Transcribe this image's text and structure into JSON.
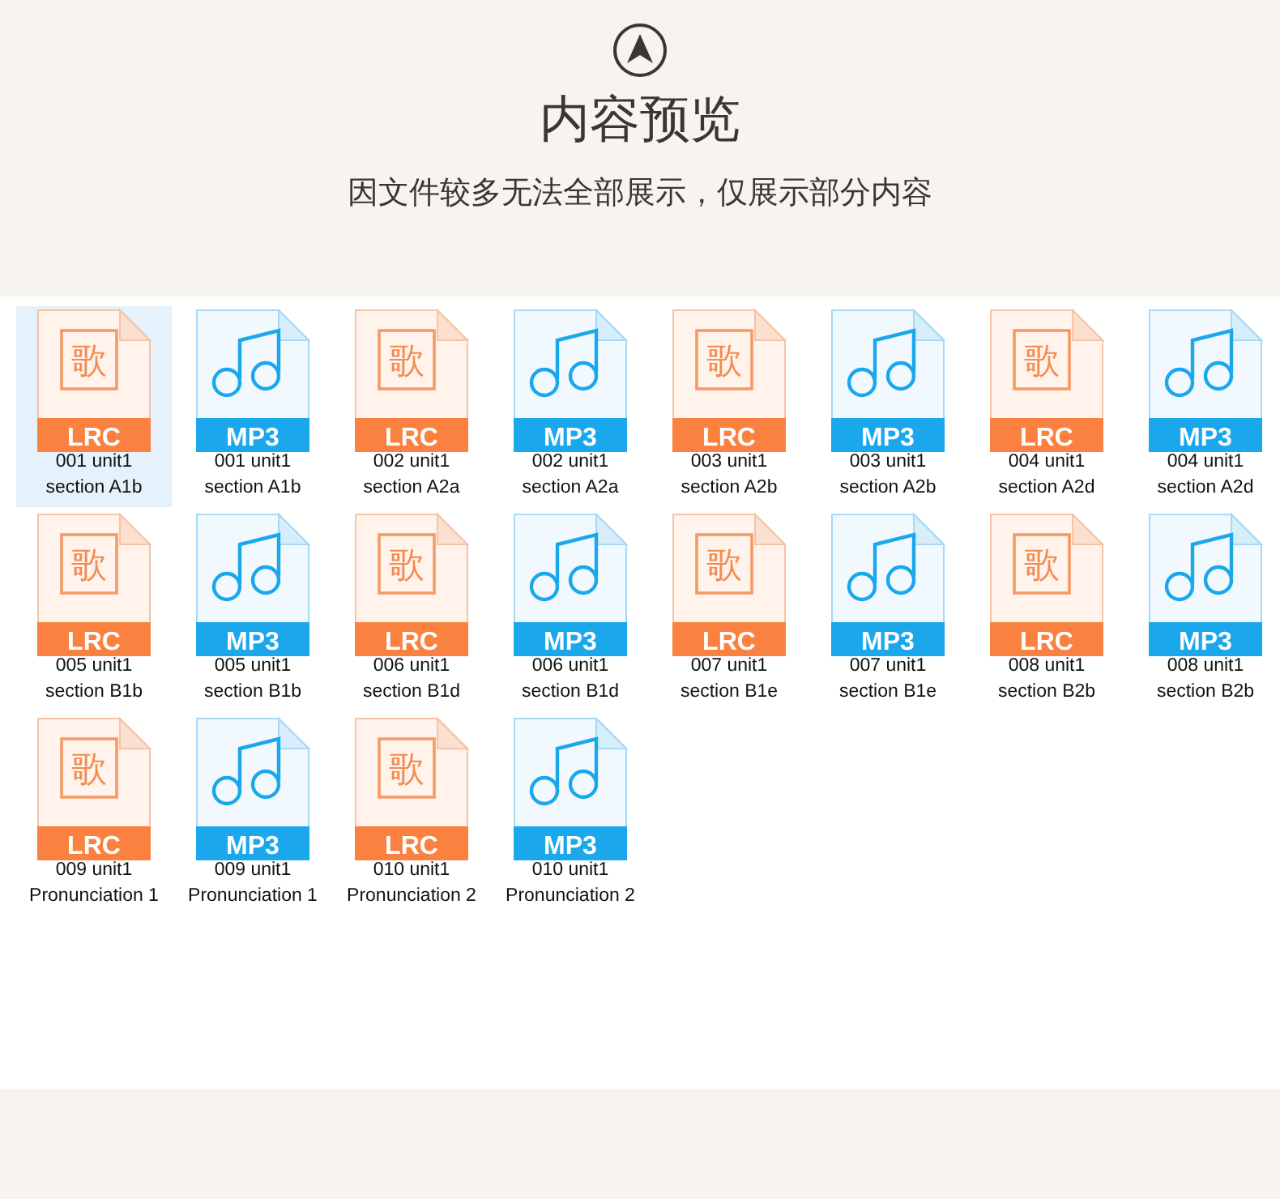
{
  "header": {
    "title": "内容预览",
    "subtitle": "因文件较多无法全部展示，仅展示部分内容"
  },
  "files": [
    {
      "kind": "lrc",
      "glyph": "歌",
      "badge": "LRC",
      "name_lines": [
        "001 unit1",
        "section A1b"
      ],
      "selected": true
    },
    {
      "kind": "mp3",
      "badge": "MP3",
      "name_lines": [
        "001 unit1",
        "section A1b"
      ],
      "selected": false
    },
    {
      "kind": "lrc",
      "glyph": "歌",
      "badge": "LRC",
      "name_lines": [
        "002 unit1",
        "section A2a"
      ],
      "selected": false
    },
    {
      "kind": "mp3",
      "badge": "MP3",
      "name_lines": [
        "002 unit1",
        "section A2a"
      ],
      "selected": false
    },
    {
      "kind": "lrc",
      "glyph": "歌",
      "badge": "LRC",
      "name_lines": [
        "003 unit1",
        "section A2b"
      ],
      "selected": false
    },
    {
      "kind": "mp3",
      "badge": "MP3",
      "name_lines": [
        "003 unit1",
        "section A2b"
      ],
      "selected": false
    },
    {
      "kind": "lrc",
      "glyph": "歌",
      "badge": "LRC",
      "name_lines": [
        "004 unit1",
        "section A2d"
      ],
      "selected": false
    },
    {
      "kind": "mp3",
      "badge": "MP3",
      "name_lines": [
        "004 unit1",
        "section A2d"
      ],
      "selected": false
    },
    {
      "kind": "lrc",
      "glyph": "歌",
      "badge": "LRC",
      "name_lines": [
        "005 unit1",
        "section B1b"
      ],
      "selected": false
    },
    {
      "kind": "mp3",
      "badge": "MP3",
      "name_lines": [
        "005 unit1",
        "section B1b"
      ],
      "selected": false
    },
    {
      "kind": "lrc",
      "glyph": "歌",
      "badge": "LRC",
      "name_lines": [
        "006 unit1",
        "section B1d"
      ],
      "selected": false
    },
    {
      "kind": "mp3",
      "badge": "MP3",
      "name_lines": [
        "006 unit1",
        "section B1d"
      ],
      "selected": false
    },
    {
      "kind": "lrc",
      "glyph": "歌",
      "badge": "LRC",
      "name_lines": [
        "007 unit1",
        "section B1e"
      ],
      "selected": false
    },
    {
      "kind": "mp3",
      "badge": "MP3",
      "name_lines": [
        "007 unit1",
        "section B1e"
      ],
      "selected": false
    },
    {
      "kind": "lrc",
      "glyph": "歌",
      "badge": "LRC",
      "name_lines": [
        "008 unit1",
        "section B2b"
      ],
      "selected": false
    },
    {
      "kind": "mp3",
      "badge": "MP3",
      "name_lines": [
        "008 unit1",
        "section B2b"
      ],
      "selected": false
    },
    {
      "kind": "lrc",
      "glyph": "歌",
      "badge": "LRC",
      "name_lines": [
        "009 unit1",
        "Pronunciation 1"
      ],
      "selected": false
    },
    {
      "kind": "mp3",
      "badge": "MP3",
      "name_lines": [
        "009 unit1",
        "Pronunciation 1"
      ],
      "selected": false
    },
    {
      "kind": "lrc",
      "glyph": "歌",
      "badge": "LRC",
      "name_lines": [
        "010 unit1",
        "Pronunciation 2"
      ],
      "selected": false
    },
    {
      "kind": "mp3",
      "badge": "MP3",
      "name_lines": [
        "010 unit1",
        "Pronunciation 2"
      ],
      "selected": false
    }
  ]
}
